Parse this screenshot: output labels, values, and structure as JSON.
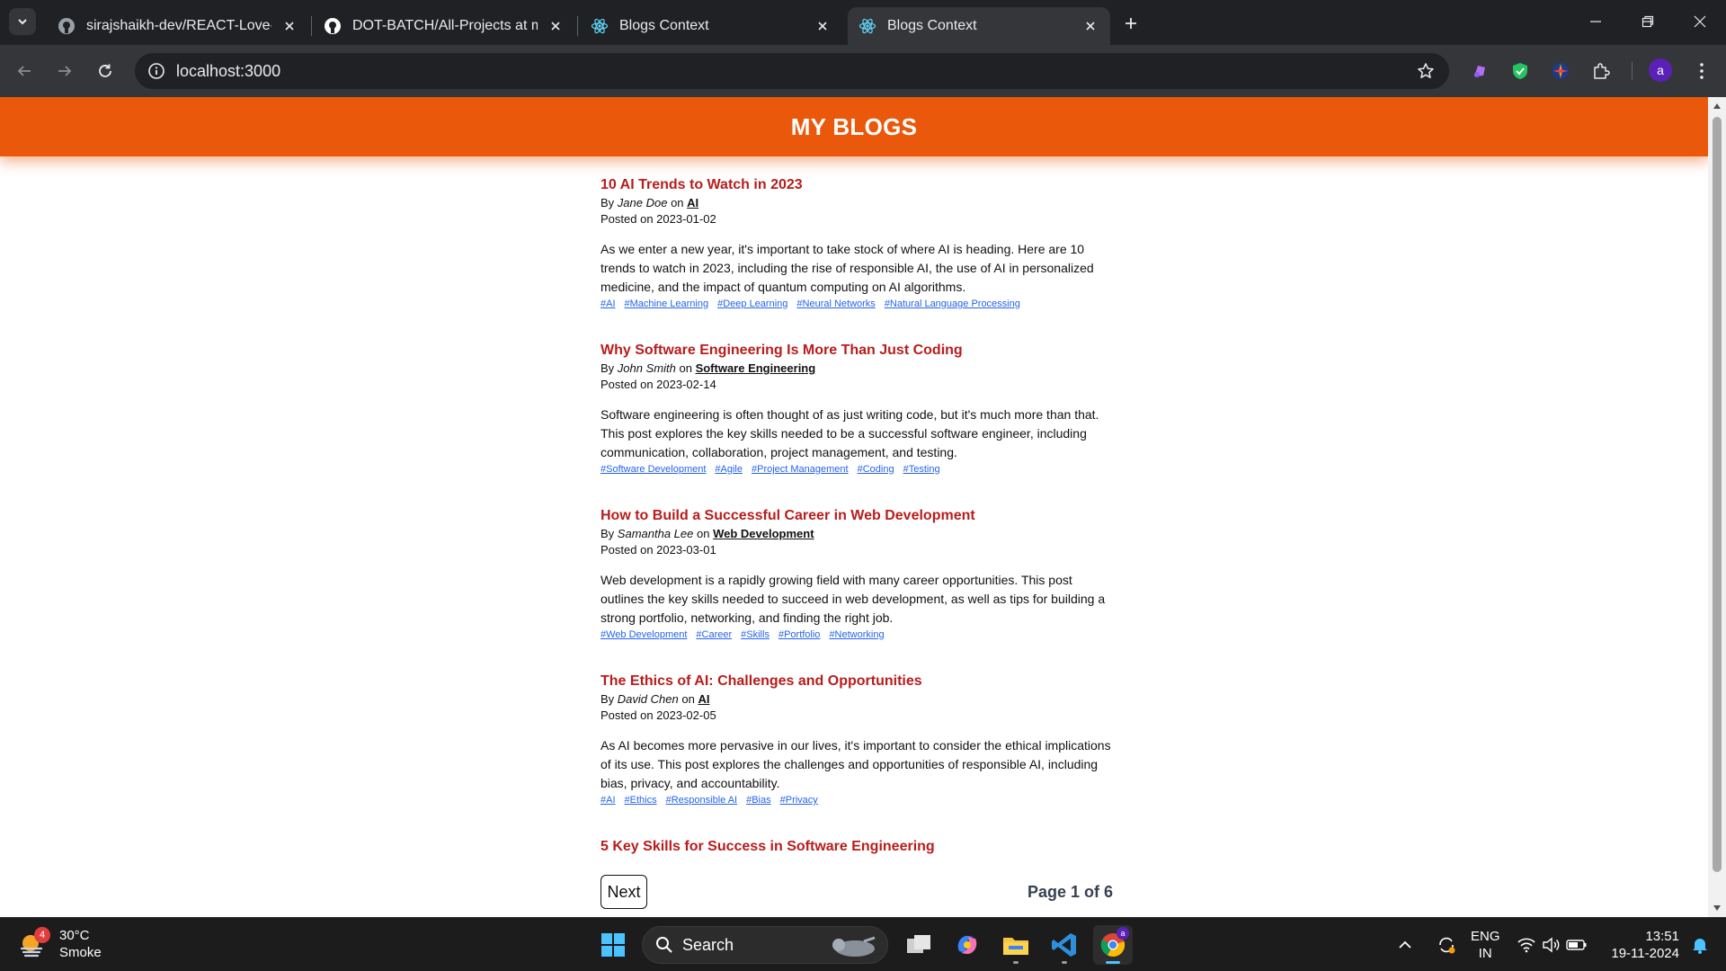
{
  "browser": {
    "tabs": [
      {
        "title": "sirajshaikh-dev/REACT-Love-Ba",
        "icon": "github-icon"
      },
      {
        "title": "DOT-BATCH/All-Projects at mas",
        "icon": "github-icon"
      },
      {
        "title": "Blogs Context",
        "icon": "react-icon"
      },
      {
        "title": "Blogs Context",
        "icon": "react-icon"
      }
    ],
    "url": "localhost:3000",
    "profile_initial": "a"
  },
  "page": {
    "header_title": "MY BLOGS",
    "by_label": "By",
    "on_label": "on",
    "posted_label": "Posted on",
    "posts": [
      {
        "title": "10 AI Trends to Watch in 2023",
        "author": "Jane Doe",
        "category": "AI",
        "date": "2023-01-02",
        "content": "As we enter a new year, it's important to take stock of where AI is heading. Here are 10 trends to watch in 2023, including the rise of responsible AI, the use of AI in personalized medicine, and the impact of quantum computing on AI algorithms.",
        "tags": [
          "#AI",
          "#Machine Learning",
          "#Deep Learning",
          "#Neural Networks",
          "#Natural Language Processing"
        ]
      },
      {
        "title": "Why Software Engineering Is More Than Just Coding",
        "author": "John Smith",
        "category": "Software Engineering",
        "date": "2023-02-14",
        "content": "Software engineering is often thought of as just writing code, but it's much more than that. This post explores the key skills needed to be a successful software engineer, including communication, collaboration, project management, and testing.",
        "tags": [
          "#Software Development",
          "#Agile",
          "#Project Management",
          "#Coding",
          "#Testing"
        ]
      },
      {
        "title": "How to Build a Successful Career in Web Development",
        "author": "Samantha Lee",
        "category": "Web Development",
        "date": "2023-03-01",
        "content": "Web development is a rapidly growing field with many career opportunities. This post outlines the key skills needed to succeed in web development, as well as tips for building a strong portfolio, networking, and finding the right job.",
        "tags": [
          "#Web Development",
          "#Career",
          "#Skills",
          "#Portfolio",
          "#Networking"
        ]
      },
      {
        "title": "The Ethics of AI: Challenges and Opportunities",
        "author": "David Chen",
        "category": "AI",
        "date": "2023-02-05",
        "content": "As AI becomes more pervasive in our lives, it's important to consider the ethical implications of its use. This post explores the challenges and opportunities of responsible AI, including bias, privacy, and accountability.",
        "tags": [
          "#AI",
          "#Ethics",
          "#Responsible AI",
          "#Bias",
          "#Privacy"
        ]
      },
      {
        "title": "5 Key Skills for Success in Software Engineering",
        "author": "",
        "category": "",
        "date": "",
        "content": "",
        "tags": []
      }
    ],
    "pagination": {
      "next_label": "Next",
      "page_info": "Page 1 of 6"
    }
  },
  "taskbar": {
    "weather": {
      "temp": "30°C",
      "condition": "Smoke",
      "badge": "4"
    },
    "search_label": "Search",
    "lang": {
      "line1": "ENG",
      "line2": "IN"
    },
    "clock": {
      "time": "13:51",
      "date": "19-11-2024"
    },
    "chrome_badge": "a"
  },
  "colors": {
    "header_bg": "#ea580c",
    "post_title": "#b91c1c",
    "tag_link": "#2563eb"
  }
}
